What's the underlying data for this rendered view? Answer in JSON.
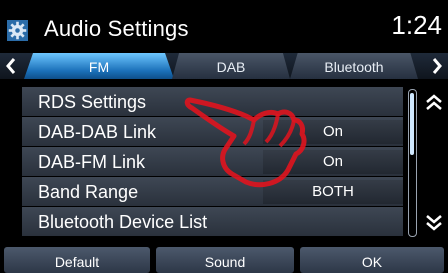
{
  "header": {
    "title": "Audio Settings",
    "clock": "1:24",
    "icon": "settings-gear-icon"
  },
  "tabs": [
    {
      "label": "FM",
      "selected": true
    },
    {
      "label": "DAB",
      "selected": false
    },
    {
      "label": "Bluetooth",
      "selected": false
    }
  ],
  "rows": [
    {
      "label": "RDS Settings",
      "value": ""
    },
    {
      "label": "DAB-DAB Link",
      "value": "On"
    },
    {
      "label": "DAB-FM Link",
      "value": "On"
    },
    {
      "label": "Band Range",
      "value": "BOTH"
    },
    {
      "label": "Bluetooth Device List",
      "value": ""
    }
  ],
  "buttons": {
    "default": "Default",
    "sound": "Sound",
    "ok": "OK"
  },
  "colors": {
    "accent_tab": "#1a6fb8",
    "hand_overlay": "#e0141e"
  }
}
